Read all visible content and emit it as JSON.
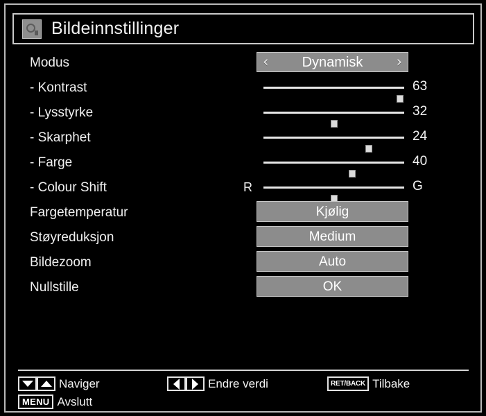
{
  "window": {
    "title": "Bildeinnstillinger",
    "title_icon": "picture-settings-icon"
  },
  "theme": {
    "background": "#000000",
    "frame_border": "#b9b9b9",
    "text": "#f2f2f2",
    "control_fill": "#8c8c8c",
    "control_border": "#c6c6c6",
    "slider_track": "#e6e6e6",
    "slider_handle": "#dcdcdc"
  },
  "menu": {
    "rows": [
      {
        "label": "Modus",
        "type": "spinner",
        "value": "Dynamisk",
        "left_arrow": "‹",
        "right_arrow": "›",
        "indent": false
      },
      {
        "label": "- Kontrast",
        "type": "slider",
        "value": "63",
        "percent": 97,
        "left_label": "",
        "right_label": "",
        "indent": true
      },
      {
        "label": "- Lysstyrke",
        "type": "slider",
        "value": "32",
        "percent": 50,
        "left_label": "",
        "right_label": "",
        "indent": true
      },
      {
        "label": "- Skarphet",
        "type": "slider",
        "value": "24",
        "percent": 75,
        "left_label": "",
        "right_label": "",
        "indent": true
      },
      {
        "label": "- Farge",
        "type": "slider",
        "value": "40",
        "percent": 63,
        "left_label": "",
        "right_label": "",
        "indent": true
      },
      {
        "label": "- Colour Shift",
        "type": "slider",
        "value": "G",
        "percent": 50,
        "left_label": "R",
        "right_label": "",
        "indent": true
      },
      {
        "label": "Fargetemperatur",
        "type": "option",
        "value": "Kjølig",
        "indent": false
      },
      {
        "label": "Støyreduksjon",
        "type": "option",
        "value": "Medium",
        "indent": false
      },
      {
        "label": "Bildezoom",
        "type": "option",
        "value": "Auto",
        "indent": false
      },
      {
        "label": "Nullstille",
        "type": "option",
        "value": "OK",
        "indent": false
      }
    ]
  },
  "footer": {
    "hints": [
      {
        "keys": [
          "arrow-down",
          "arrow-up"
        ],
        "key_text": "",
        "label": "Naviger"
      },
      {
        "keys": [],
        "key_text": "MENU",
        "label": "Avslutt"
      },
      {
        "keys": [
          "arrow-left",
          "arrow-right"
        ],
        "key_text": "",
        "label": "Endre verdi"
      },
      {
        "keys": [],
        "key_text": "RET/BACK",
        "label": "Tilbake"
      }
    ]
  }
}
